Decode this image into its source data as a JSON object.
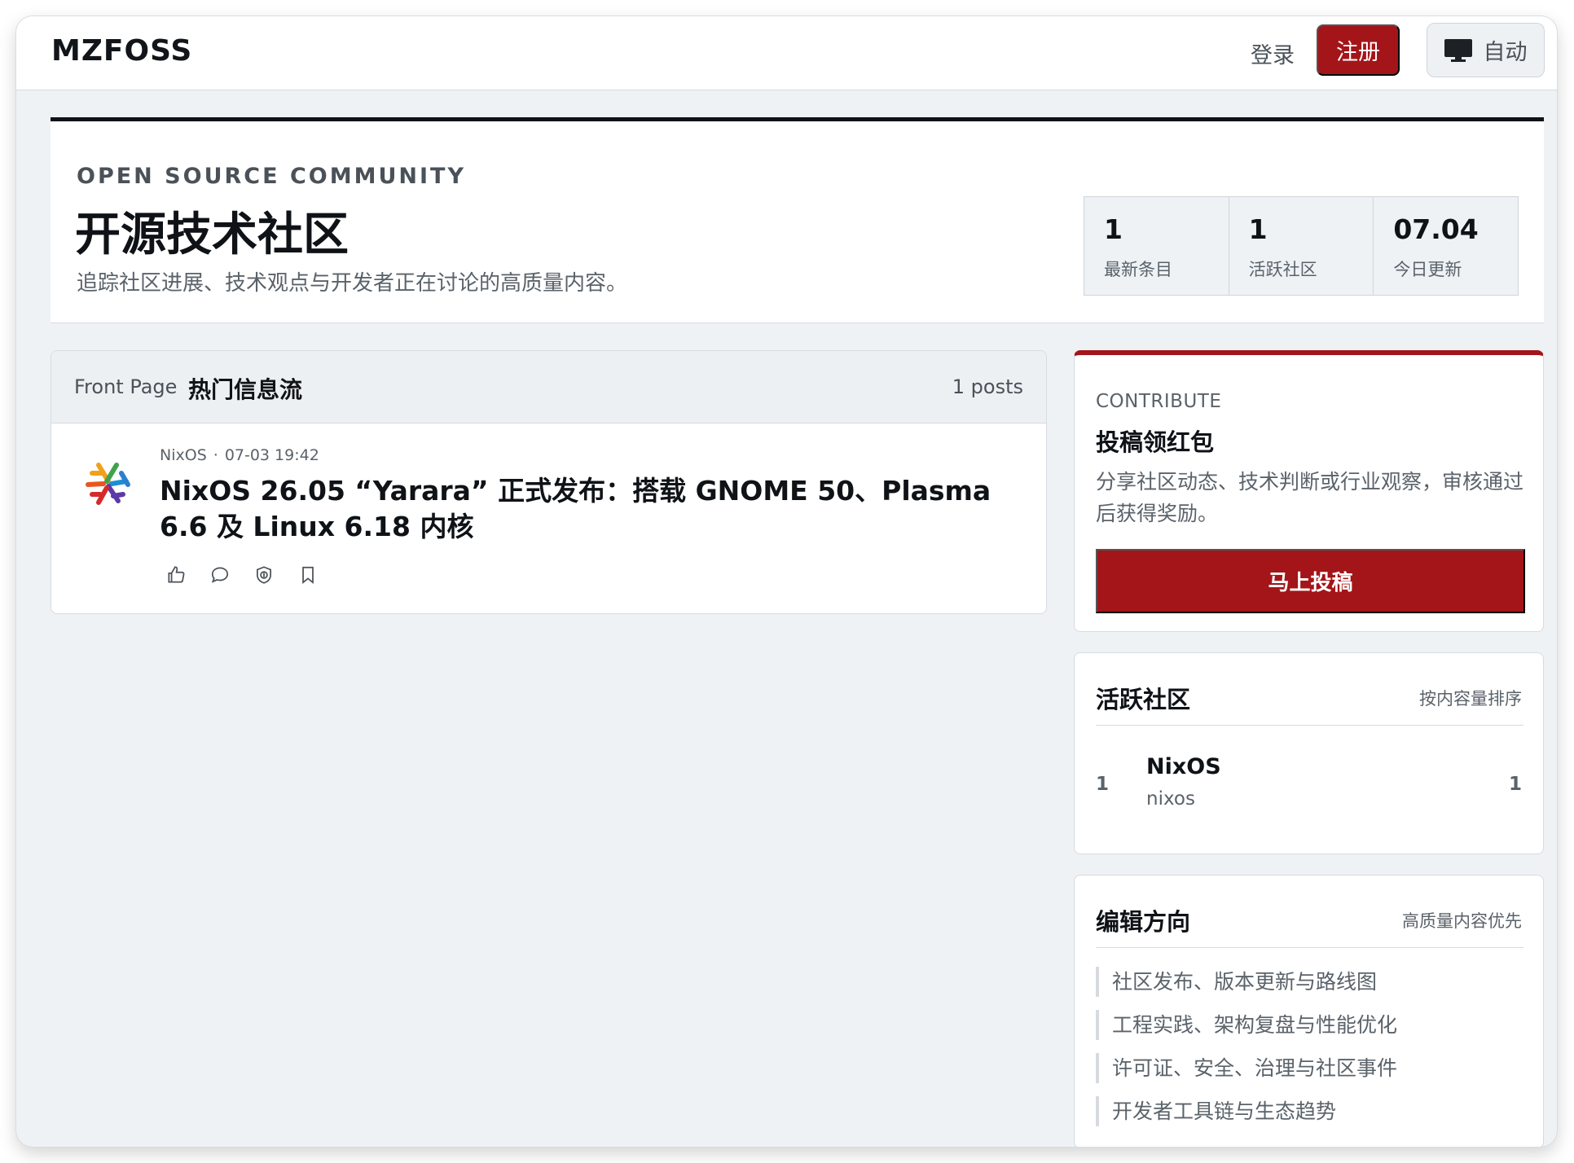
{
  "header": {
    "logo": "MZFOSS",
    "login_label": "登录",
    "signup_label": "注册",
    "theme_label": "自动",
    "theme_icon": "monitor-icon"
  },
  "hero": {
    "kicker": "OPEN SOURCE COMMUNITY",
    "title": "开源技术社区",
    "subtitle": "追踪社区进展、技术观点与开发者正在讨论的高质量内容。",
    "stats": [
      {
        "value": "1",
        "label": "最新条目"
      },
      {
        "value": "1",
        "label": "活跃社区"
      },
      {
        "value": "07.04",
        "label": "今日更新"
      }
    ]
  },
  "feed": {
    "kicker": "Front Page",
    "title": "热门信息流",
    "count": "1 posts",
    "posts": [
      {
        "community": "NixOS",
        "time": "07-03 19:42",
        "title": "NixOS 26.05 “Yarara” 正式发布：搭载 GNOME 50、Plasma 6.6 及 Linux 6.18 内核",
        "actions": [
          "thumbs-up-icon",
          "comment-icon",
          "shield-coin-icon",
          "bookmark-icon"
        ]
      }
    ]
  },
  "contribute": {
    "kicker": "CONTRIBUTE",
    "title": "投稿领红包",
    "description": "分享社区动态、技术判断或行业观察，审核通过后获得奖励。",
    "button": "马上投稿",
    "accent": "#a31519"
  },
  "active_communities": {
    "title": "活跃社区",
    "hint": "按内容量排序",
    "items": [
      {
        "rank": "1",
        "name": "NixOS",
        "slug": "nixos",
        "count": "1"
      }
    ]
  },
  "editorial": {
    "title": "编辑方向",
    "hint": "高质量内容优先",
    "items": [
      "社区发布、版本更新与路线图",
      "工程实践、架构复盘与性能优化",
      "许可证、安全、治理与社区事件",
      "开发者工具链与生态趋势"
    ]
  }
}
